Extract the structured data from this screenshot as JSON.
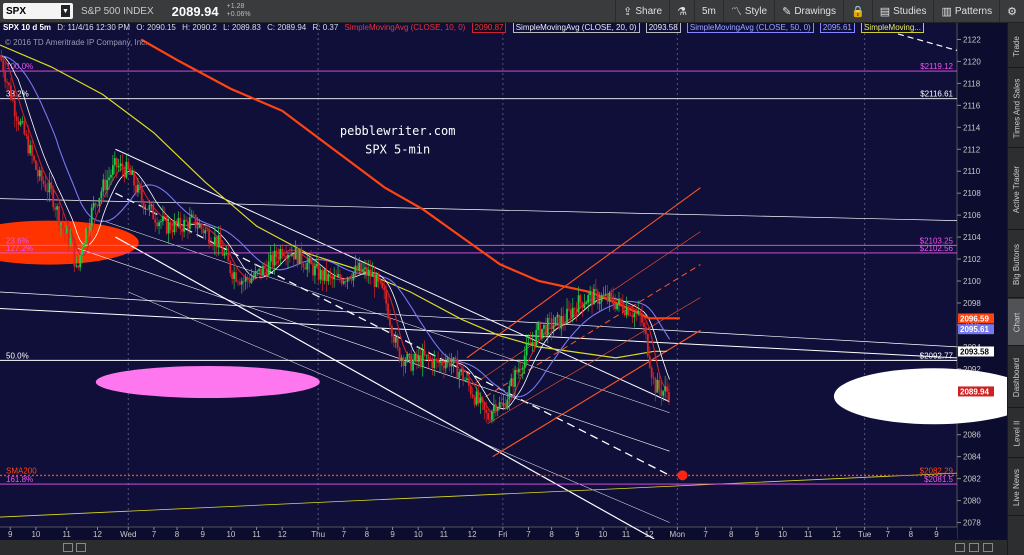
{
  "toolbar": {
    "symbol": "SPX",
    "description": "S&P 500 INDEX",
    "price": "2089.94",
    "change_abs": "+1.28",
    "change_pct": "+0.06%",
    "share_label": "Share",
    "timeframe_label": "5m",
    "style_label": "Style",
    "drawings_label": "Drawings",
    "studies_label": "Studies",
    "patterns_label": "Patterns"
  },
  "info": {
    "symbol": "SPX 10 d 5m",
    "datetime": "D: 11/4/16 12:30 PM",
    "open": "O: 2090.15",
    "high": "H: 2090.2",
    "low": "L: 2089.83",
    "close": "C: 2089.94",
    "range": "R: 0.37",
    "sma10_label": "SimpleMovingAvg (CLOSE, 10, 0)",
    "sma10_value": "2090.87",
    "sma20_label": "SimpleMovingAvg (CLOSE, 20, 0)",
    "sma20_value": "2093.58",
    "sma50_label": "SimpleMovingAvg (CLOSE, 50, 0)",
    "sma50_value": "2095.61",
    "sma200_label": "SimpleMoving...",
    "copyright": "© 2016 TD Ameritrade IP Company, Inc."
  },
  "annotation": {
    "line1": "pebblewriter.com",
    "line2": "SPX 5-min"
  },
  "side_tabs": [
    "Trade",
    "Times And Sales",
    "Active Trader",
    "Big Buttons",
    "Chart",
    "Dashboard",
    "Level II",
    "Live News"
  ],
  "colors": {
    "background": "#0f0f3a",
    "sma10": "#cc2222",
    "sma20": "#ffffff",
    "sma50": "#7777ee",
    "sma200": "#ff4411",
    "sma_yellow": "#dddd22",
    "channel_orange": "#ff5522",
    "fib_magenta": "#ee55ee",
    "candle_up": "#22cc44",
    "candle_down": "#dd2222"
  },
  "chart_data": {
    "type": "candlestick",
    "ylim": [
      2076.5,
      2123.5
    ],
    "y_ticks": [
      2078,
      2080,
      2082,
      2084,
      2086,
      2088,
      2090,
      2092,
      2094,
      2096,
      2098,
      2100,
      2102,
      2104,
      2106,
      2108,
      2110,
      2112,
      2114,
      2116,
      2118,
      2120,
      2122
    ],
    "x_ticks": [
      "9",
      "10",
      "11",
      "12",
      "Wed",
      "7",
      "8",
      "9",
      "10",
      "11",
      "12",
      "Thu",
      "7",
      "8",
      "9",
      "10",
      "11",
      "12",
      "Fri",
      "7",
      "8",
      "9",
      "10",
      "11",
      "12",
      "Mon",
      "7",
      "8",
      "9",
      "10",
      "11",
      "12",
      "Tue",
      "7",
      "8",
      "9"
    ],
    "x_tick_pos": [
      0.4,
      1.4,
      2.6,
      3.8,
      5.0,
      6.0,
      6.9,
      7.9,
      9.0,
      10.0,
      11.0,
      12.4,
      13.4,
      14.3,
      15.3,
      16.3,
      17.3,
      18.4,
      19.6,
      20.6,
      21.5,
      22.5,
      23.5,
      24.4,
      25.3,
      26.4,
      27.5,
      28.5,
      29.5,
      30.5,
      31.5,
      32.6,
      33.7,
      34.6,
      35.5,
      36.5
    ],
    "x_range": [
      0,
      37.3
    ],
    "price_path": [
      [
        0.0,
        2120.5
      ],
      [
        0.6,
        2115.5
      ],
      [
        1.0,
        2113.0
      ],
      [
        1.5,
        2109.5
      ],
      [
        2.0,
        2108.0
      ],
      [
        2.5,
        2104.5
      ],
      [
        2.8,
        2103.5
      ],
      [
        3.0,
        2100.5
      ],
      [
        3.2,
        2103.5
      ],
      [
        3.6,
        2106.5
      ],
      [
        4.0,
        2108.5
      ],
      [
        4.5,
        2110.5
      ],
      [
        5.0,
        2110.0
      ],
      [
        5.5,
        2107.5
      ],
      [
        6.0,
        2106.0
      ],
      [
        6.5,
        2105.0
      ],
      [
        7.0,
        2105.0
      ],
      [
        7.5,
        2105.5
      ],
      [
        8.0,
        2104.5
      ],
      [
        8.5,
        2103.5
      ],
      [
        9.0,
        2101.0
      ],
      [
        9.5,
        2100.0
      ],
      [
        10.0,
        2100.5
      ],
      [
        10.5,
        2101.5
      ],
      [
        11.0,
        2103.0
      ],
      [
        11.5,
        2102.5
      ],
      [
        12.0,
        2101.5
      ],
      [
        12.5,
        2100.5
      ],
      [
        13.0,
        2100.0
      ],
      [
        13.5,
        2100.5
      ],
      [
        14.0,
        2101.0
      ],
      [
        14.5,
        2100.5
      ],
      [
        15.0,
        2098.5
      ],
      [
        15.5,
        2093.5
      ],
      [
        16.0,
        2092.5
      ],
      [
        16.5,
        2093.0
      ],
      [
        17.0,
        2092.5
      ],
      [
        17.5,
        2092.8
      ],
      [
        18.0,
        2091.5
      ],
      [
        18.5,
        2089.5
      ],
      [
        19.0,
        2087.5
      ],
      [
        19.3,
        2089.0
      ],
      [
        19.6,
        2088.5
      ],
      [
        20.0,
        2091.0
      ],
      [
        20.5,
        2093.5
      ],
      [
        21.0,
        2095.5
      ],
      [
        21.5,
        2096.0
      ],
      [
        22.0,
        2096.5
      ],
      [
        22.5,
        2098.0
      ],
      [
        23.0,
        2098.5
      ],
      [
        23.5,
        2098.5
      ],
      [
        24.0,
        2098.0
      ],
      [
        24.5,
        2097.5
      ],
      [
        25.0,
        2096.5
      ],
      [
        25.2,
        2094.5
      ],
      [
        25.5,
        2090.5
      ],
      [
        25.8,
        2090.0
      ],
      [
        26.1,
        2089.9
      ]
    ],
    "sma200_path": [
      [
        5.5,
        2122.0
      ],
      [
        7.0,
        2120.0
      ],
      [
        9.0,
        2117.5
      ],
      [
        11.0,
        2115.5
      ],
      [
        13.0,
        2112.0
      ],
      [
        15.0,
        2108.5
      ],
      [
        16.5,
        2106.5
      ],
      [
        18.0,
        2104.0
      ],
      [
        19.5,
        2101.5
      ],
      [
        21.0,
        2100.0
      ],
      [
        23.0,
        2099.0
      ],
      [
        24.5,
        2097.5
      ],
      [
        25.3,
        2096.6
      ],
      [
        26.5,
        2096.6
      ]
    ],
    "sma_yellow_path": [
      [
        0.0,
        2121.5
      ],
      [
        2.0,
        2119.5
      ],
      [
        4.0,
        2117.0
      ],
      [
        6.0,
        2113.5
      ],
      [
        8.0,
        2109.0
      ],
      [
        10.0,
        2105.0
      ],
      [
        12.0,
        2102.5
      ],
      [
        14.0,
        2101.0
      ],
      [
        16.0,
        2099.0
      ],
      [
        18.0,
        2096.5
      ],
      [
        19.5,
        2095.0
      ],
      [
        21.0,
        2094.0
      ],
      [
        22.5,
        2093.5
      ],
      [
        24.0,
        2093.0
      ],
      [
        25.5,
        2093.6
      ],
      [
        26.0,
        2093.6
      ]
    ],
    "horizontal_levels": [
      {
        "value": 2119.12,
        "label": "100.0%",
        "price_label": "$2119.12",
        "color": "#ee55ee"
      },
      {
        "value": 2116.61,
        "label": "38.2%",
        "price_label": "$2116.61",
        "color": "#ffffff"
      },
      {
        "value": 2103.25,
        "label": "23.6%",
        "price_label": "$2103.25",
        "color": "#ee55ee"
      },
      {
        "value": 2102.56,
        "label": "127.2%",
        "price_label": "$2102.56",
        "color": "#ee55ee"
      },
      {
        "value": 2092.77,
        "label": "50.0%",
        "price_label": "$2092.77",
        "color": "#ffffff"
      },
      {
        "value": 2082.29,
        "label": "SMA200",
        "price_label": "$2082.29",
        "color": "#ff4411"
      },
      {
        "value": 2081.5,
        "label": "161.8%",
        "price_label": "$2081.5",
        "color": "#ee55ee"
      }
    ],
    "price_badges": [
      {
        "value": 2096.59,
        "text": "2096.59",
        "color": "#ff4411"
      },
      {
        "value": 2095.61,
        "text": "2095.61",
        "color": "#7777ee"
      },
      {
        "value": 2093.58,
        "text": "2093.58",
        "color": "#ffffff"
      },
      {
        "value": 2089.94,
        "text": "2089.94",
        "color": "#cc2222"
      }
    ]
  }
}
